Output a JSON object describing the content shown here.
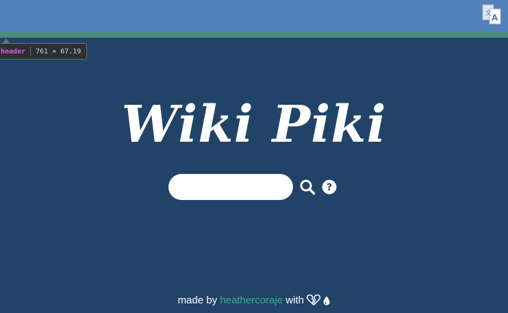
{
  "header": {
    "translate_icon": "translate-icon",
    "colors": {
      "bar": "#5381b9",
      "stripe": "#4b8c78"
    }
  },
  "devtools_tooltip": {
    "tag": "header",
    "size": "761 × 67.19"
  },
  "main": {
    "title": "Wiki Piki",
    "search": {
      "value": "",
      "placeholder": "",
      "search_icon": "search-icon",
      "help_icon": "question-circle-icon"
    }
  },
  "footer": {
    "prefix": "made by ",
    "author": "heathercoraje",
    "suffix": " with ",
    "icons": [
      "broken-heart-icon",
      "drop-icon"
    ],
    "colors": {
      "link": "#35b38a"
    }
  },
  "colors": {
    "background": "#214367"
  }
}
